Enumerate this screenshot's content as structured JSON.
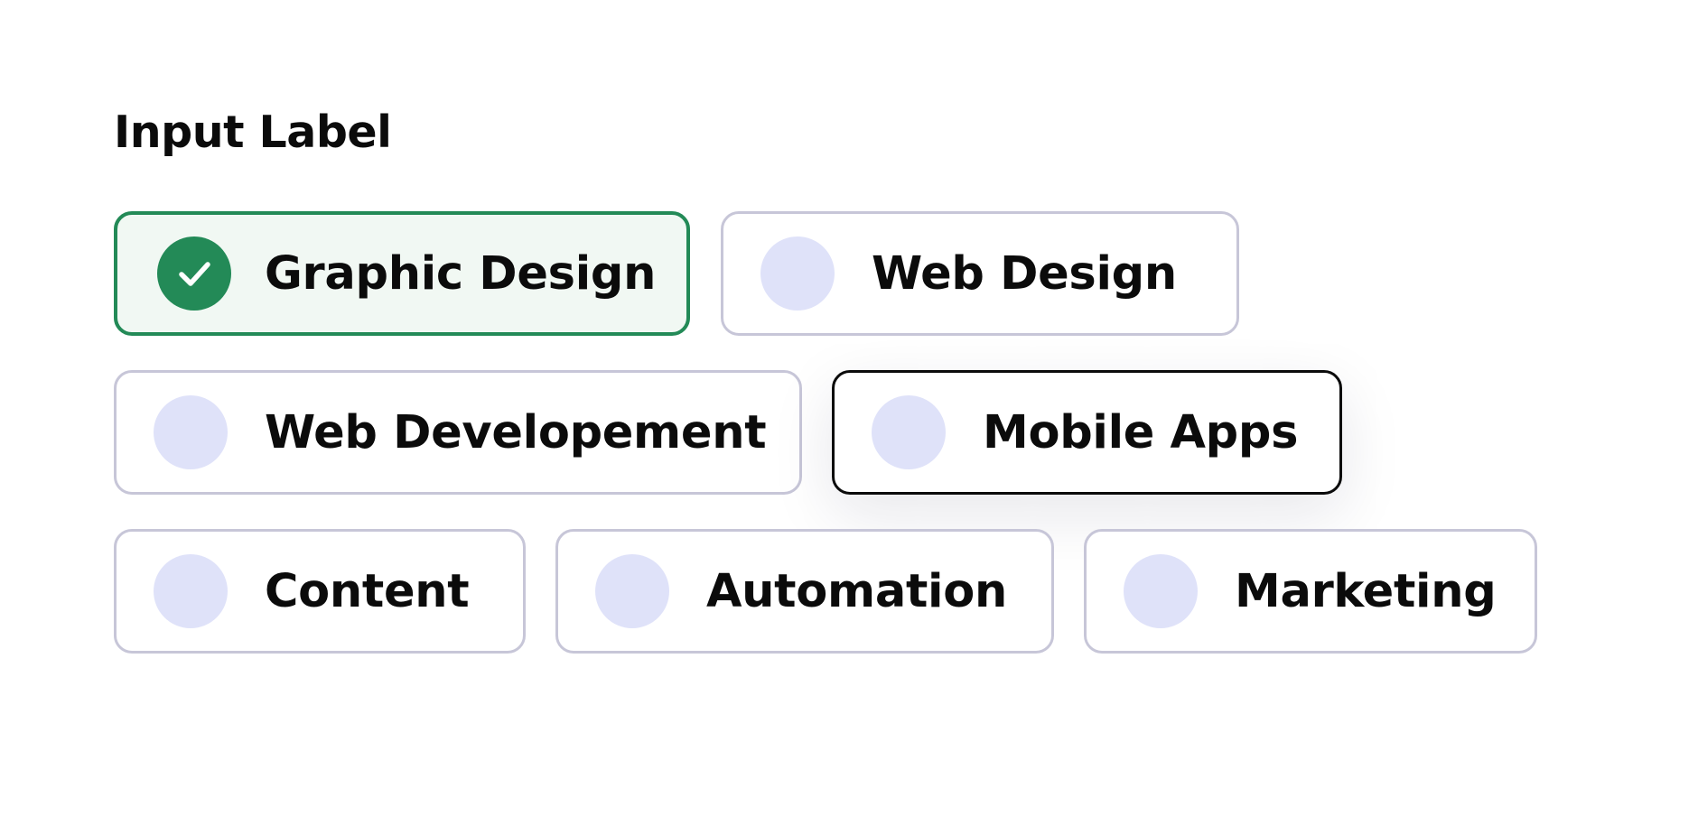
{
  "field": {
    "label": "Input Label"
  },
  "colors": {
    "accent": "#238a57",
    "accent_bg": "#f1f8f3",
    "radio_idle": "#dfe2f9",
    "chip_border": "#c7c6d8",
    "focus_border": "#0b0b0b"
  },
  "options": [
    {
      "label": "Graphic Design",
      "selected": true,
      "icon": "check-circle-icon"
    },
    {
      "label": "Web Design",
      "selected": false
    },
    {
      "label": "Web Developement",
      "selected": false
    },
    {
      "label": "Mobile Apps",
      "selected": false,
      "focused": true
    },
    {
      "label": "Content",
      "selected": false
    },
    {
      "label": "Automation",
      "selected": false
    },
    {
      "label": "Marketing",
      "selected": false
    }
  ]
}
